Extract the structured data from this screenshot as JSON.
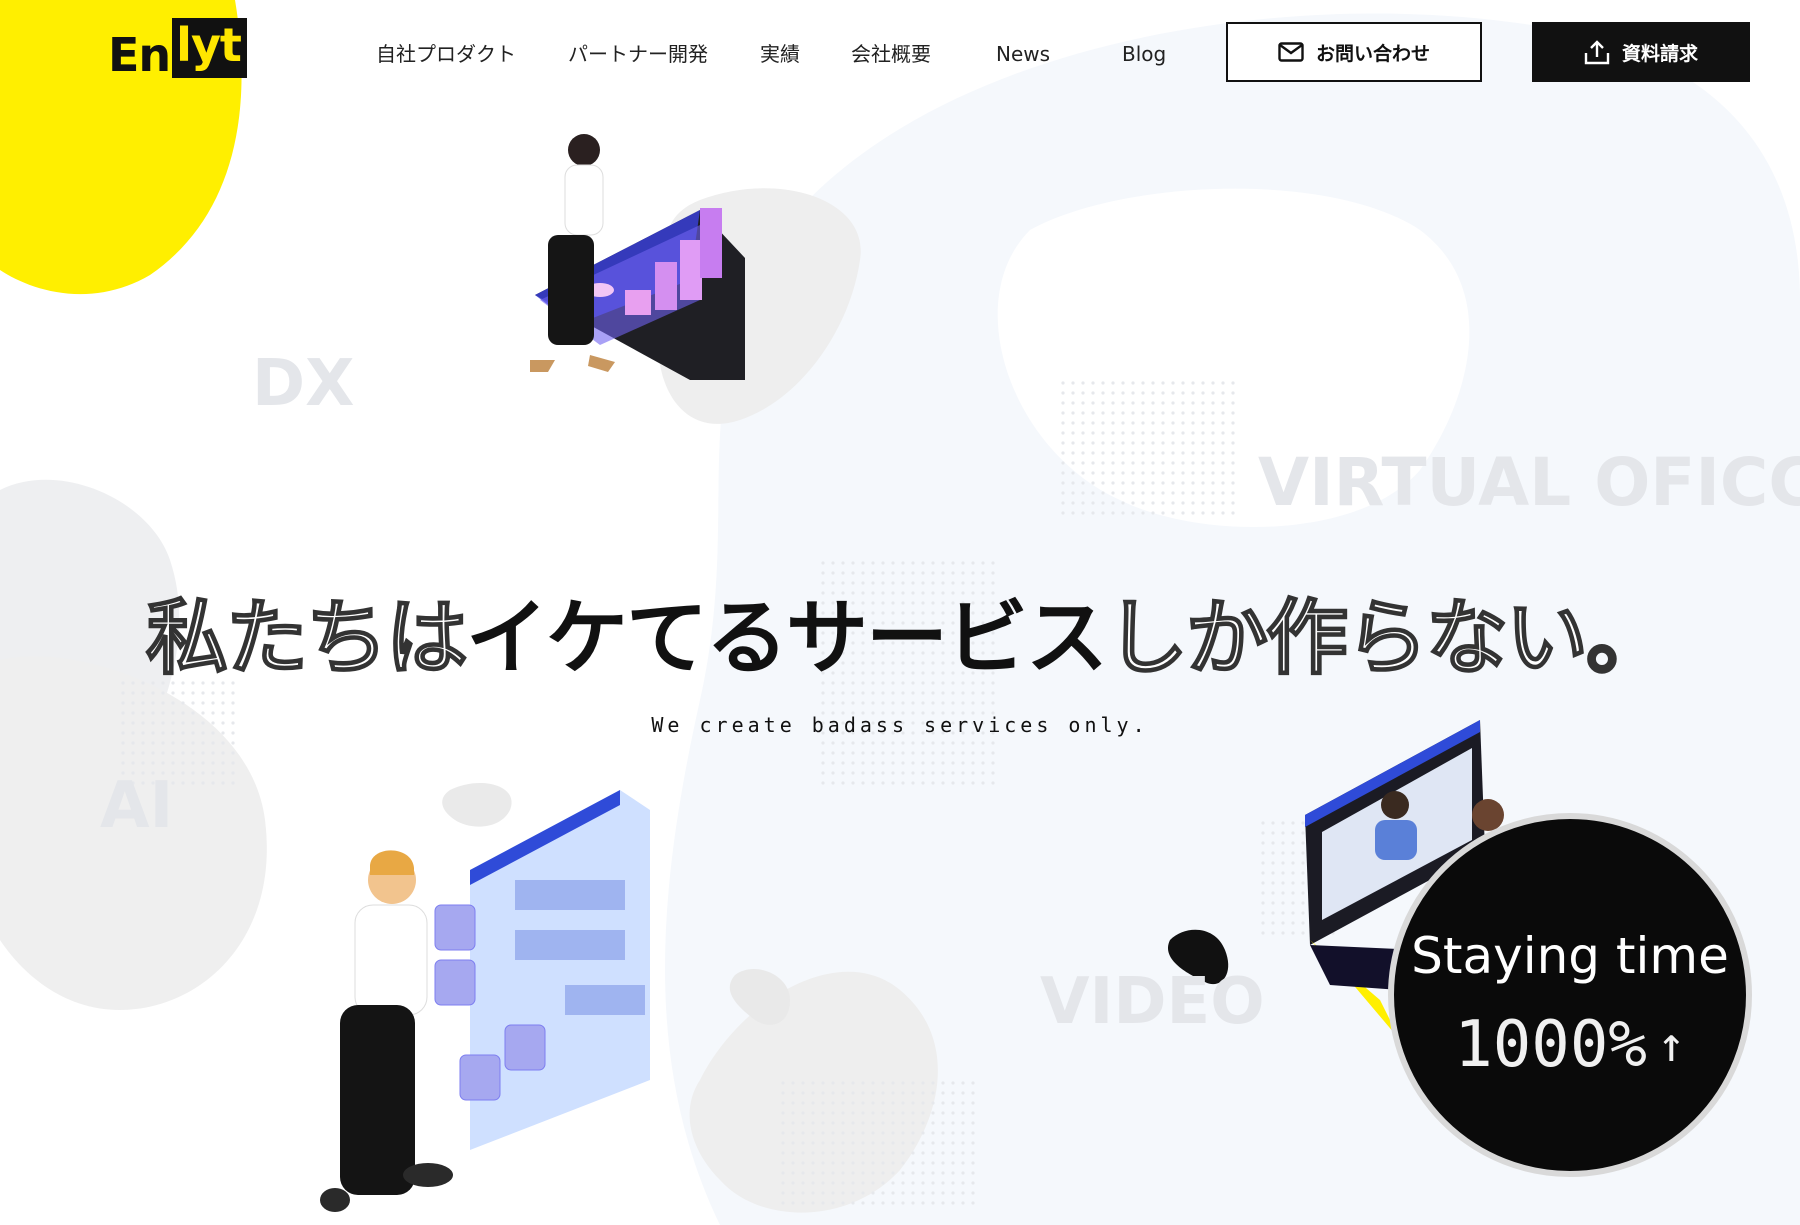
{
  "brand": {
    "logo_text_plain": "En",
    "logo_text_boxed": "lyt",
    "accent_color": "#ffe600"
  },
  "nav": {
    "items": [
      {
        "label": "自社プロダクト"
      },
      {
        "label": "パートナー開発"
      },
      {
        "label": "実績"
      },
      {
        "label": "会社概要"
      },
      {
        "label": "News"
      },
      {
        "label": "Blog"
      }
    ]
  },
  "actions": {
    "contact_label": "お問い合わせ",
    "contact_icon": "mail-icon",
    "request_label": "資料請求",
    "request_icon": "upload-icon"
  },
  "background_words": {
    "dx": "DX",
    "virtual_office": "VIRTUAL OFICCE",
    "ai": "AI",
    "video": "VIDEO"
  },
  "hero": {
    "headline_part1": "私たちは",
    "headline_part2": "イケてるサービス",
    "headline_part3": "しか作らない。",
    "subheadline": "We create badass services only."
  },
  "stat": {
    "label": "Staying time",
    "value": "1000%",
    "arrow": "↑"
  }
}
